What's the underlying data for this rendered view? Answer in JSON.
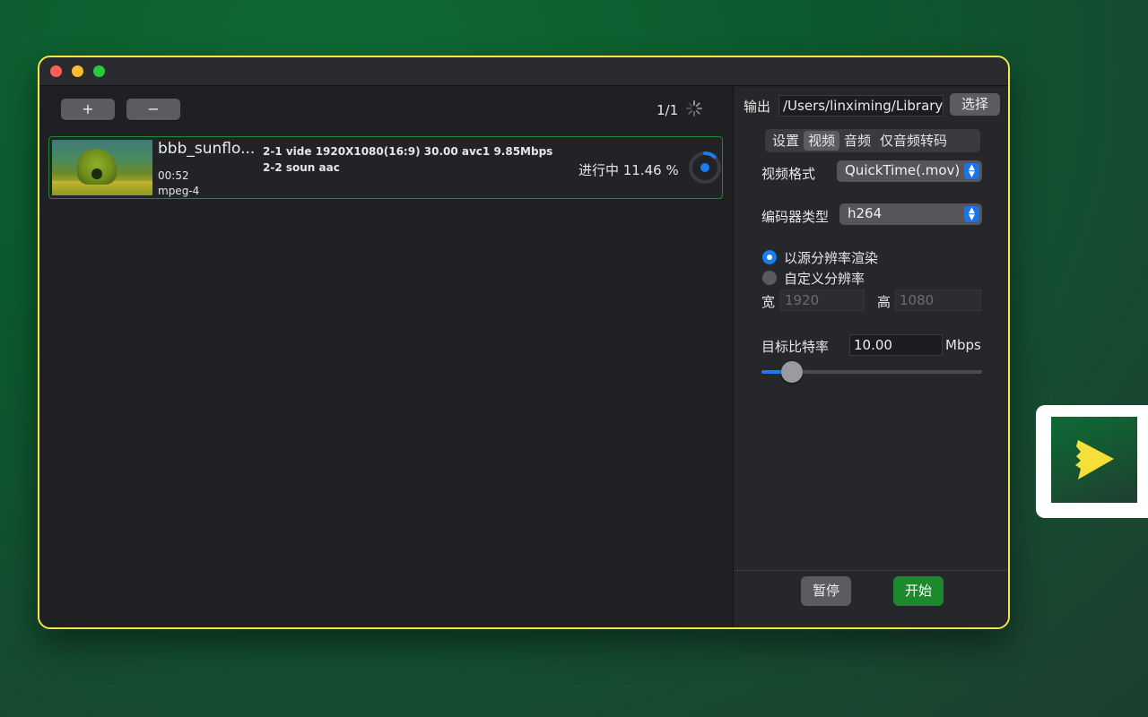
{
  "toolbar": {
    "add_label": "+",
    "remove_label": "−",
    "counter": "1/1"
  },
  "file": {
    "name": "bbb_sunflo...",
    "duration": "00:52",
    "container": "mpeg-4",
    "stream1": "2-1 vide 1920X1080(16:9) 30.00 avc1 9.85Mbps",
    "stream2": "2-2 soun aac",
    "status": "进行中 11.46 %",
    "progress": 0.1146
  },
  "output": {
    "label": "输出",
    "path": "/Users/linximing/Library/Containers",
    "choose_label": "选择"
  },
  "tabs": [
    {
      "label": "设置",
      "active": false
    },
    {
      "label": "视频",
      "active": true
    },
    {
      "label": "音频",
      "active": false
    },
    {
      "label": "仅音频转码",
      "active": false
    }
  ],
  "video": {
    "format_label": "视频格式",
    "format_value": "QuickTime(.mov)",
    "encoder_label": "编码器类型",
    "encoder_value": "h264",
    "radio_source": "以源分辨率渲染",
    "radio_custom": "自定义分辨率",
    "width_label": "宽",
    "width_placeholder": "1920",
    "height_label": "高",
    "height_placeholder": "1080",
    "bitrate_label": "目标比特率",
    "bitrate_value": "10.00",
    "bitrate_unit": "Mbps",
    "bitrate_slider": 0.14
  },
  "actions": {
    "pause_label": "暂停",
    "start_label": "开始"
  },
  "colors": {
    "accent_blue": "#1a7cf0",
    "start_green": "#1c8a2c",
    "window_border": "#f2e94a"
  }
}
